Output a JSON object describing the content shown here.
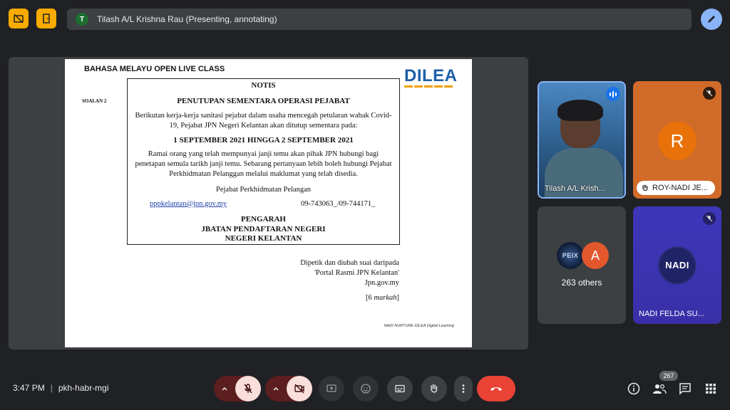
{
  "top": {
    "presenter_initial": "T",
    "presenter_label": "Tilash A/L Krishna Rau (Presenting, annotating)",
    "icons": [
      "captions-off-icon",
      "door-icon",
      "annotate-pen-icon"
    ]
  },
  "document": {
    "course": "BAHASA MELAYU OPEN LIVE CLASS",
    "logo": "DILEA",
    "question": "SOALAN 2",
    "notice_title": "NOTIS",
    "notice_subtitle": "PENUTUPAN SEMENTARA OPERASI PEJABAT",
    "para1": "Berikutan kerja-kerja sanitasi pejabat dalam usaha mencegah petularan wabak Covid-19, Pejabat JPN Negeri Kelantan akan ditutup sementara pada:",
    "dates": "1 SEPTEMBER 2021 HINGGA 2 SEPTEMBER 2021",
    "para2": "Ramai orang yang telah mempunyai janji temu akan pihak JPN hubungi bagi penetapan semula tarikh janji temu. Sebarang pertanyaan lebih boleh hubungi Pejabat Perkhidmatan Pelanggan melalui maklumat yang telah disedia.",
    "office": "Pejabat Perkhidmatan Pelangan",
    "email": "pppkelantan@jpn.gov.my",
    "phone": "09-743063_/09-744171_",
    "sig1": "PENGARAH",
    "sig2": "JBATAN PENDAFTARAN NEGERI",
    "sig3": "NEGERI KELANTAN",
    "source1": "Dipetik dan diubah suai daripada",
    "source2": "'Portal Rasmi JPN Kelantan'",
    "source3": "Jpn.gov.my",
    "marks_open": "[6 ",
    "marks_word": "markah",
    "marks_close": "]",
    "footer": "NADI NURTURE DILEA Digital Learning"
  },
  "tiles": {
    "tile1_name": "Tilash A/L Krish...",
    "tile2_initial": "R",
    "tile2_name": "ROY-NADI JE...",
    "tile3_avatar1": "PEIX",
    "tile3_avatar2": "A",
    "tile3_label": "263 others",
    "tile4_logo": "NADI",
    "tile4_name": "NADI FELDA SU..."
  },
  "bottom": {
    "time": "3:47 PM",
    "separator": "|",
    "meeting_code": "pkh-habr-mgi",
    "participant_count": "267"
  },
  "colors": {
    "background": "#202124",
    "accent_yellow": "#f9ab00",
    "accent_blue": "#8ab4f8",
    "hangup_red": "#ea4335",
    "dilea_blue": "#1d5fa8",
    "dilea_orange": "#f29f05"
  }
}
